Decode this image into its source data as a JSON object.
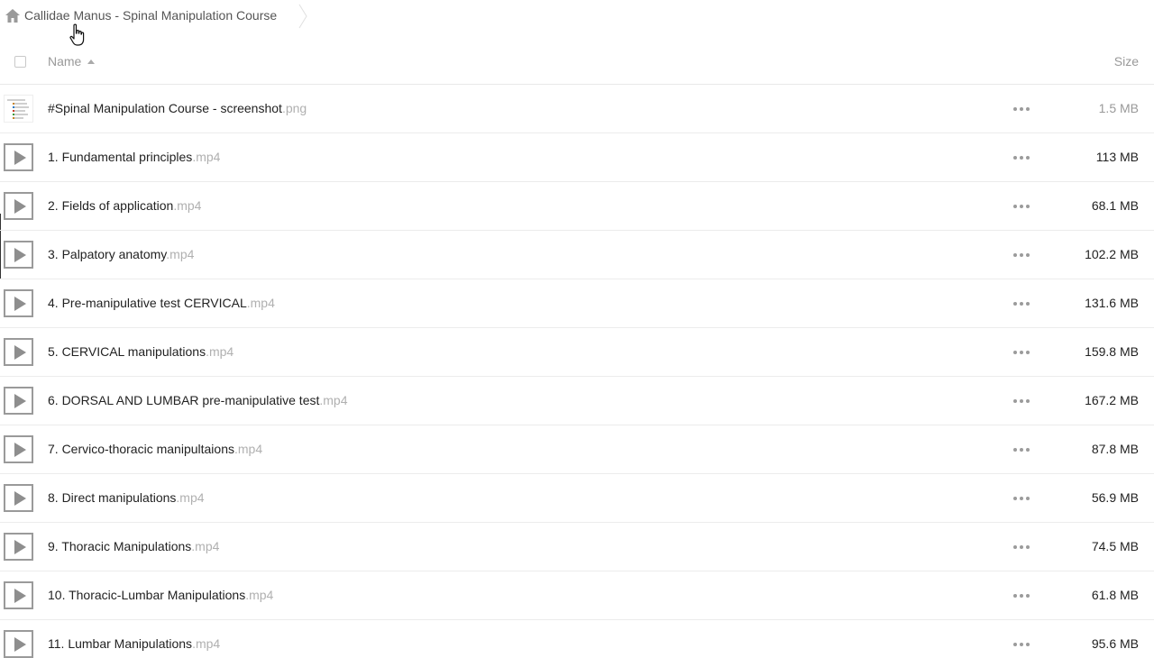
{
  "breadcrumb": {
    "label": "Callidae Manus - Spinal Manipulation Course"
  },
  "header": {
    "name_label": "Name",
    "size_label": "Size"
  },
  "files": [
    {
      "name": "#Spinal Manipulation Course - screenshot",
      "ext": ".png",
      "size": "1.5 MB",
      "type": "image"
    },
    {
      "name": "1. Fundamental principles",
      "ext": ".mp4",
      "size": "113 MB",
      "type": "video"
    },
    {
      "name": "2. Fields of application",
      "ext": ".mp4",
      "size": "68.1 MB",
      "type": "video"
    },
    {
      "name": "3. Palpatory anatomy",
      "ext": ".mp4",
      "size": "102.2 MB",
      "type": "video"
    },
    {
      "name": "4. Pre-manipulative test CERVICAL",
      "ext": ".mp4",
      "size": "131.6 MB",
      "type": "video"
    },
    {
      "name": "5. CERVICAL manipulations",
      "ext": ".mp4",
      "size": "159.8 MB",
      "type": "video"
    },
    {
      "name": "6. DORSAL AND LUMBAR pre-manipulative test",
      "ext": ".mp4",
      "size": "167.2 MB",
      "type": "video"
    },
    {
      "name": "7. Cervico-thoracic manipultaions",
      "ext": ".mp4",
      "size": "87.8 MB",
      "type": "video"
    },
    {
      "name": "8. Direct manipulations",
      "ext": ".mp4",
      "size": "56.9 MB",
      "type": "video"
    },
    {
      "name": "9. Thoracic Manipulations",
      "ext": ".mp4",
      "size": "74.5 MB",
      "type": "video"
    },
    {
      "name": "10. Thoracic-Lumbar Manipulations",
      "ext": ".mp4",
      "size": "61.8 MB",
      "type": "video"
    },
    {
      "name": "11. Lumbar Manipulations",
      "ext": ".mp4",
      "size": "95.6 MB",
      "type": "video"
    }
  ],
  "icons": {
    "home": "home-icon",
    "breadcrumb_separator": "chevron-right-icon",
    "sort": "sort-ascending-icon",
    "image_file": "image-thumbnail-icon",
    "video_file": "play-icon",
    "more": "more-options-icon",
    "cursor": "hand-pointer-cursor"
  },
  "colors": {
    "text": "#222222",
    "muted": "#999999",
    "extension": "#b0b0b0",
    "divider": "#ececec",
    "icon": "#9a9a9a"
  }
}
